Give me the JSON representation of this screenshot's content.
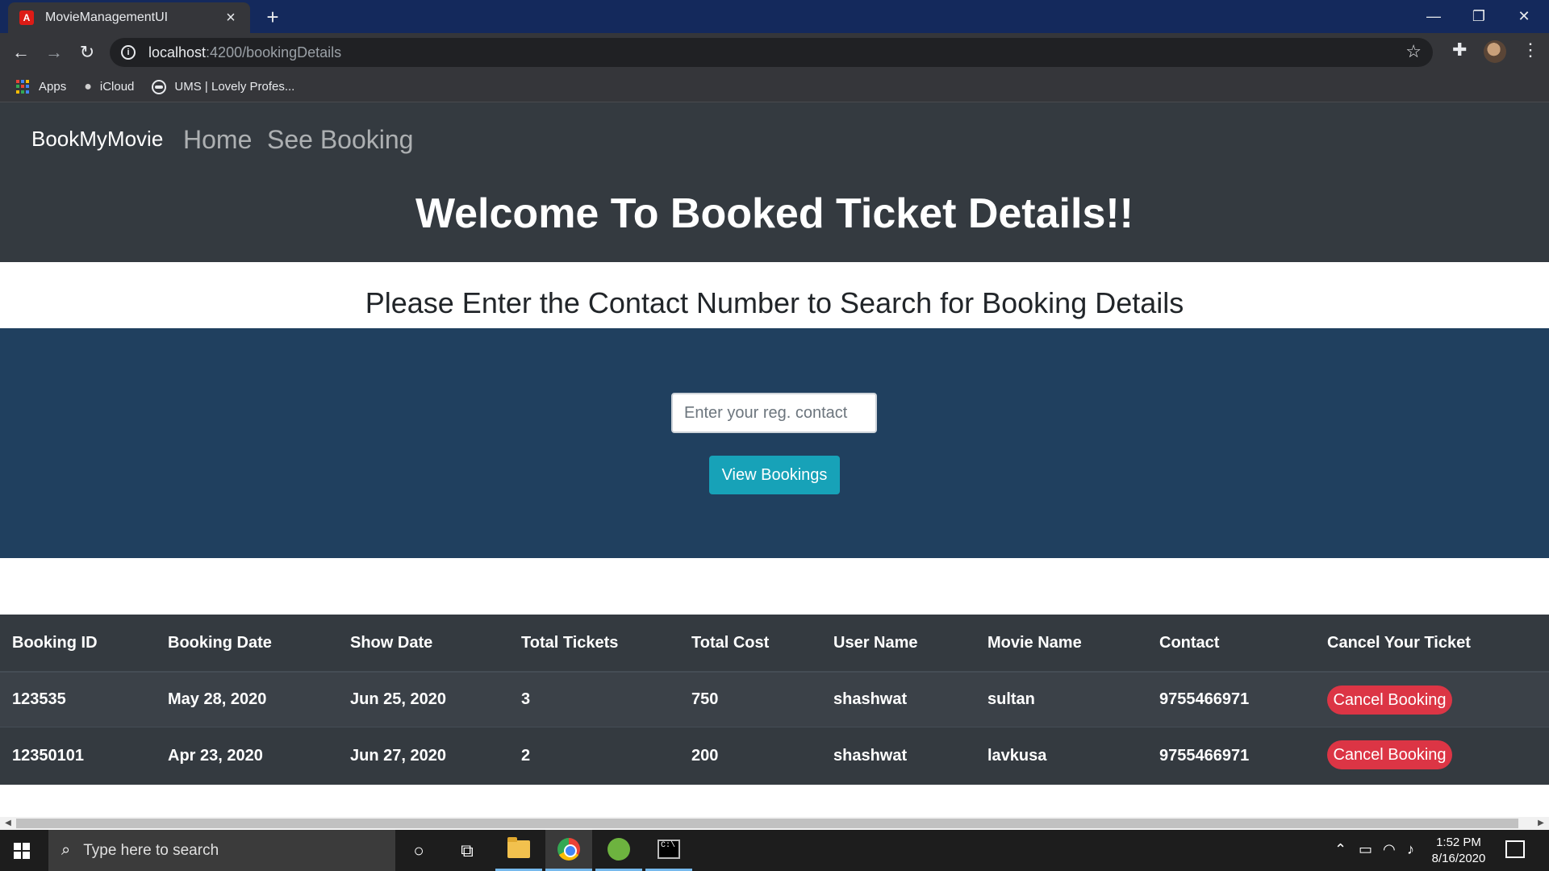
{
  "browser": {
    "tab_title": "MovieManagementUI",
    "tab_favicon_letter": "A",
    "url_host": "localhost",
    "url_path": ":4200/bookingDetails",
    "bookmarks": [
      {
        "label": "Apps",
        "icon": "apps-grid-icon"
      },
      {
        "label": "iCloud",
        "icon": "apple-icon"
      },
      {
        "label": "UMS | Lovely Profes...",
        "icon": "globe-icon"
      }
    ]
  },
  "navbar": {
    "brand": "BookMyMovie",
    "links": [
      "Home",
      "See Booking"
    ]
  },
  "hero": {
    "title": "Welcome To Booked Ticket Details!!"
  },
  "search": {
    "subtitle": "Please Enter the Contact Number to Search for Booking Details",
    "input_placeholder": "Enter your reg. contact",
    "input_value": "",
    "button_label": "View Bookings"
  },
  "table": {
    "headers": [
      "Booking ID",
      "Booking Date",
      "Show Date",
      "Total Tickets",
      "Total Cost",
      "User Name",
      "Movie Name",
      "Contact",
      "Cancel Your Ticket"
    ],
    "rows": [
      {
        "booking_id": "123535",
        "booking_date": "May 28, 2020",
        "show_date": "Jun 25, 2020",
        "total_tickets": "3",
        "total_cost": "750",
        "user_name": "shashwat",
        "movie_name": "sultan",
        "contact": "9755466971",
        "action": "Cancel Booking"
      },
      {
        "booking_id": "12350101",
        "booking_date": "Apr 23, 2020",
        "show_date": "Jun 27, 2020",
        "total_tickets": "2",
        "total_cost": "200",
        "user_name": "shashwat",
        "movie_name": "lavkusa",
        "contact": "9755466971",
        "action": "Cancel Booking"
      }
    ]
  },
  "taskbar": {
    "search_placeholder": "Type here to search",
    "time": "1:52 PM",
    "date": "8/16/2020"
  },
  "colors": {
    "navbar_bg": "#343a40",
    "search_band_bg": "#20405f",
    "view_button": "#17a2b8",
    "cancel_button": "#dc3545"
  }
}
